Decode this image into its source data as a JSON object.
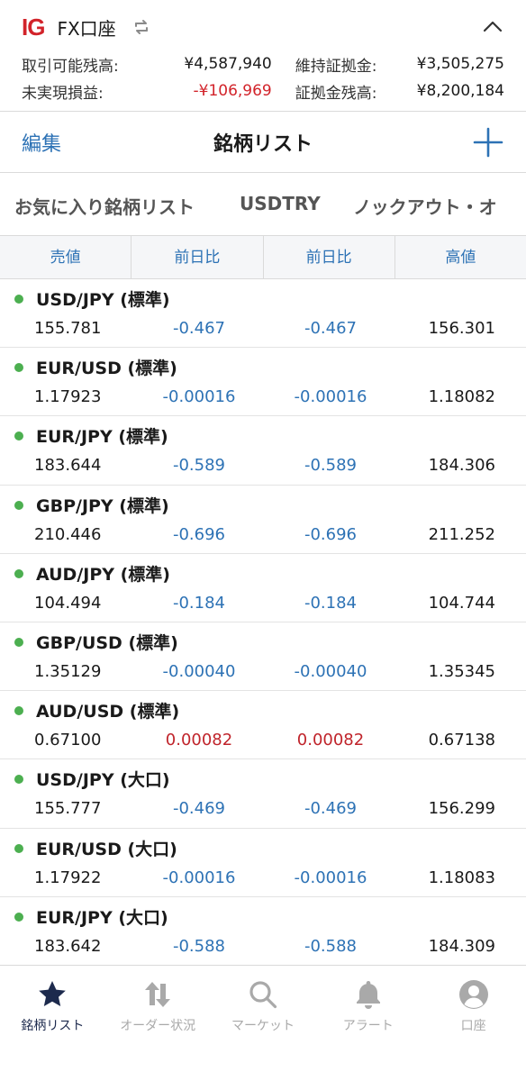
{
  "account": {
    "logo": "IG",
    "name": "FX口座",
    "rows": [
      {
        "label1": "取引可能残高:",
        "value1": "¥4,587,940",
        "label2": "維持証拠金:",
        "value2": "¥3,505,275"
      },
      {
        "label1": "未実現損益:",
        "value1": "-¥106,969",
        "label2": "証拠金残高:",
        "value2": "¥8,200,184"
      }
    ]
  },
  "nav": {
    "edit": "編集",
    "title": "銘柄リスト"
  },
  "tabs": [
    "お気に入り銘柄リスト",
    "USDTRY",
    "ノックアウト・オ"
  ],
  "columns": [
    "売値",
    "前日比",
    "前日比",
    "高値"
  ],
  "rows": [
    {
      "name": "USD/JPY (標準)",
      "sell": "155.781",
      "chg1": "-0.467",
      "chg2": "-0.467",
      "high": "156.301"
    },
    {
      "name": "EUR/USD (標準)",
      "sell": "1.17923",
      "chg1": "-0.00016",
      "chg2": "-0.00016",
      "high": "1.18082"
    },
    {
      "name": "EUR/JPY (標準)",
      "sell": "183.644",
      "chg1": "-0.589",
      "chg2": "-0.589",
      "high": "184.306"
    },
    {
      "name": "GBP/JPY (標準)",
      "sell": "210.446",
      "chg1": "-0.696",
      "chg2": "-0.696",
      "high": "211.252"
    },
    {
      "name": "AUD/JPY (標準)",
      "sell": "104.494",
      "chg1": "-0.184",
      "chg2": "-0.184",
      "high": "104.744"
    },
    {
      "name": "GBP/USD (標準)",
      "sell": "1.35129",
      "chg1": "-0.00040",
      "chg2": "-0.00040",
      "high": "1.35345"
    },
    {
      "name": "AUD/USD (標準)",
      "sell": "0.67100",
      "chg1": "0.00082",
      "chg2": "0.00082",
      "high": "0.67138"
    },
    {
      "name": "USD/JPY (大口)",
      "sell": "155.777",
      "chg1": "-0.469",
      "chg2": "-0.469",
      "high": "156.299"
    },
    {
      "name": "EUR/USD (大口)",
      "sell": "1.17922",
      "chg1": "-0.00016",
      "chg2": "-0.00016",
      "high": "1.18083"
    },
    {
      "name": "EUR/JPY (大口)",
      "sell": "183.642",
      "chg1": "-0.588",
      "chg2": "-0.588",
      "high": "184.309"
    }
  ],
  "bottom_tabs": [
    {
      "label": "銘柄リスト",
      "icon": "star-icon"
    },
    {
      "label": "オーダー状況",
      "icon": "order-arrows-icon"
    },
    {
      "label": "マーケット",
      "icon": "search-icon"
    },
    {
      "label": "アラート",
      "icon": "bell-icon"
    },
    {
      "label": "口座",
      "icon": "account-icon"
    }
  ],
  "colors": {
    "brand_red": "#d2232a",
    "link_blue": "#2d72b5",
    "status_green": "#4caf50",
    "active_navy": "#1d2a4d",
    "inactive_gray": "#a9a9a9"
  }
}
